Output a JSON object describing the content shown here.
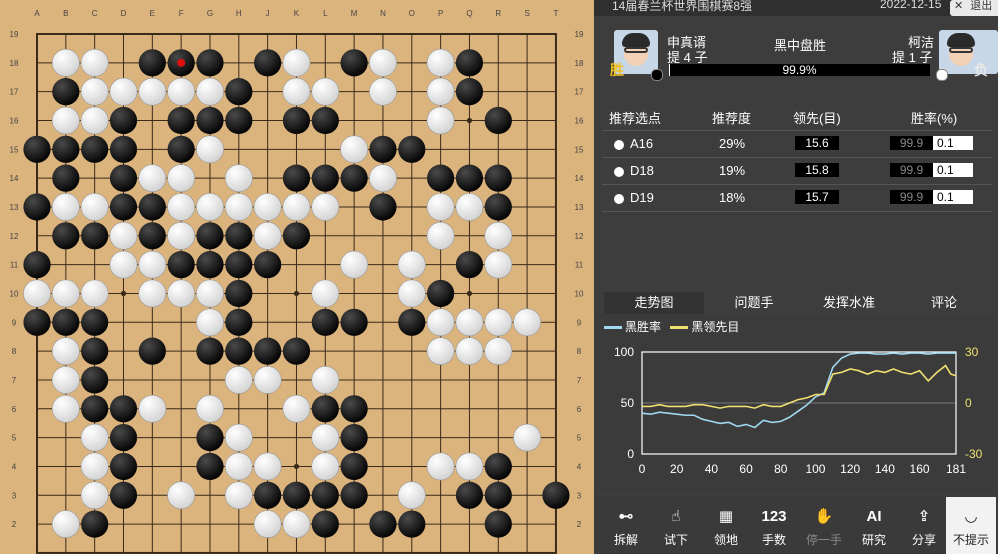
{
  "board": {
    "col_labels": [
      "A",
      "B",
      "C",
      "D",
      "E",
      "F",
      "G",
      "H",
      "J",
      "K",
      "L",
      "M",
      "N",
      "O",
      "P",
      "Q",
      "R",
      "S",
      "T"
    ],
    "row_labels_visible": [
      "19",
      "18",
      "17",
      "16",
      "15",
      "14",
      "13",
      "12",
      "11",
      "10",
      "9",
      "8",
      "7",
      "6",
      "5",
      "4",
      "3",
      "2"
    ],
    "last_move": "F18",
    "colors": {
      "wood": "#dbb37d",
      "line": "#3a2a18",
      "last_move_marker": "#e01010"
    },
    "stones": {
      "black": [
        "E18",
        "F18",
        "G18",
        "J18",
        "M18",
        "Q18",
        "B17",
        "H17",
        "Q17",
        "D16",
        "F16",
        "G16",
        "H16",
        "K16",
        "L16",
        "R16",
        "A15",
        "B15",
        "C15",
        "D15",
        "F15",
        "N15",
        "O15",
        "B14",
        "D14",
        "K14",
        "L14",
        "M14",
        "P14",
        "Q14",
        "R14",
        "A13",
        "D13",
        "E13",
        "N13",
        "R13",
        "B12",
        "C12",
        "E12",
        "G12",
        "H12",
        "K12",
        "A11",
        "F11",
        "G11",
        "H11",
        "J11",
        "Q11",
        "H10",
        "P10",
        "A9",
        "B9",
        "C9",
        "H9",
        "L9",
        "M9",
        "O9",
        "C8",
        "E8",
        "G8",
        "H8",
        "J8",
        "K8",
        "C7",
        "C6",
        "D6",
        "L6",
        "M6",
        "D5",
        "G5",
        "M5",
        "D4",
        "G4",
        "M4",
        "R4",
        "D3",
        "J3",
        "K3",
        "L3",
        "M3",
        "Q3",
        "R3",
        "T3",
        "C2",
        "L2",
        "N2",
        "O2",
        "R2"
      ],
      "white": [
        "B18",
        "C18",
        "K18",
        "N18",
        "P18",
        "C17",
        "D17",
        "E17",
        "F17",
        "G17",
        "K17",
        "L17",
        "N17",
        "P17",
        "B16",
        "C16",
        "P16",
        "G15",
        "M15",
        "E14",
        "F14",
        "H14",
        "N14",
        "B13",
        "C13",
        "F13",
        "G13",
        "H13",
        "J13",
        "K13",
        "L13",
        "P13",
        "Q13",
        "D12",
        "F12",
        "J12",
        "P12",
        "R12",
        "D11",
        "E11",
        "M11",
        "O11",
        "R11",
        "A10",
        "B10",
        "C10",
        "E10",
        "F10",
        "G10",
        "L10",
        "O10",
        "G9",
        "P9",
        "Q9",
        "R9",
        "S9",
        "B8",
        "P8",
        "Q8",
        "R8",
        "B7",
        "H7",
        "J7",
        "L7",
        "B6",
        "E6",
        "G6",
        "K6",
        "C5",
        "H5",
        "L5",
        "S5",
        "C4",
        "H4",
        "J4",
        "L4",
        "P4",
        "Q4",
        "C3",
        "F3",
        "H3",
        "O3",
        "B2",
        "J2",
        "K2"
      ]
    }
  },
  "panel": {
    "title": "14届春兰杯世界围棋赛8强",
    "date": "2022-12-15",
    "close_label": "退出",
    "result": "黑中盘胜",
    "black_player": {
      "name": "申真谞",
      "captures": "提 4 子",
      "win_badge": "胜"
    },
    "white_player": {
      "name": "柯洁",
      "captures": "提 1 子",
      "loss_badge": "负"
    },
    "winrate_text": "99.9%",
    "winrate_value": 99.9,
    "table": {
      "headers": [
        "推荐选点",
        "推荐度",
        "领先(目)",
        "胜率(%)"
      ],
      "rows": [
        {
          "move": "A16",
          "pct": "29%",
          "lead": "15.6",
          "win_black": "99.9",
          "win_white": "0.1"
        },
        {
          "move": "D18",
          "pct": "19%",
          "lead": "15.8",
          "win_black": "99.9",
          "win_white": "0.1"
        },
        {
          "move": "D19",
          "pct": "18%",
          "lead": "15.7",
          "win_black": "99.9",
          "win_white": "0.1"
        }
      ]
    },
    "tabs": [
      "走势图",
      "问题手",
      "发挥水准",
      "评论"
    ],
    "active_tab": 0,
    "toolbar": [
      {
        "label": "拆解",
        "icon": "split-icon",
        "glyph": "⊷",
        "disabled": false
      },
      {
        "label": "试下",
        "icon": "hand-point-icon",
        "glyph": "☝",
        "disabled": false
      },
      {
        "label": "领地",
        "icon": "territory-icon",
        "glyph": "▦",
        "disabled": false
      },
      {
        "label": "手数",
        "icon": "move-number-icon",
        "glyph": "123",
        "disabled": false
      },
      {
        "label": "停一手",
        "icon": "palm-icon",
        "glyph": "✋",
        "disabled": true
      },
      {
        "label": "研究",
        "icon": "ai-icon",
        "glyph": "AI",
        "disabled": false
      },
      {
        "label": "分享",
        "icon": "share-icon",
        "glyph": "⇪",
        "disabled": false
      },
      {
        "label": "不提示",
        "icon": "eye-closed-icon",
        "glyph": "◡",
        "disabled": false,
        "highlight": true
      }
    ]
  },
  "chart_data": {
    "type": "line",
    "legend": [
      "黑胜率",
      "黑领先目"
    ],
    "colors": {
      "winrate": "#9fd8f0",
      "lead": "#f0e070",
      "grid": "#7a7a7a",
      "frame": "#ffffff"
    },
    "xlim": [
      0,
      181
    ],
    "x_ticks": [
      0,
      20,
      40,
      60,
      80,
      100,
      120,
      140,
      160,
      181
    ],
    "ylim_left": [
      0,
      100
    ],
    "y_ticks_left": [
      0,
      50,
      100
    ],
    "ylim_right": [
      -30,
      30
    ],
    "y_ticks_right": [
      -30,
      0,
      30
    ],
    "series": [
      {
        "name": "黑胜率",
        "axis": "left",
        "x": [
          0,
          5,
          10,
          15,
          20,
          25,
          30,
          35,
          40,
          45,
          50,
          55,
          60,
          65,
          70,
          75,
          80,
          85,
          90,
          95,
          100,
          105,
          110,
          115,
          120,
          125,
          130,
          135,
          140,
          145,
          150,
          155,
          160,
          165,
          170,
          175,
          178,
          181
        ],
        "y": [
          40,
          39,
          41,
          40,
          39,
          38,
          38,
          34,
          32,
          30,
          31,
          27,
          29,
          26,
          33,
          31,
          32,
          36,
          42,
          48,
          56,
          60,
          85,
          94,
          98,
          99,
          99,
          98,
          98,
          99,
          98,
          99,
          99,
          98,
          99,
          99,
          99,
          99
        ]
      },
      {
        "name": "黑领先目",
        "axis": "right",
        "x": [
          0,
          5,
          10,
          15,
          20,
          25,
          30,
          35,
          40,
          45,
          50,
          55,
          60,
          65,
          70,
          75,
          80,
          85,
          90,
          95,
          100,
          105,
          110,
          115,
          120,
          125,
          130,
          135,
          140,
          145,
          150,
          155,
          160,
          165,
          170,
          175,
          178,
          181
        ],
        "y": [
          -2,
          -2,
          -1,
          -2,
          -2,
          -2,
          -1,
          -1,
          -2,
          -3,
          -2,
          -2,
          -2,
          -3,
          -1,
          -2,
          -2,
          0,
          2,
          3,
          5,
          5,
          17,
          18,
          20,
          19,
          17,
          19,
          18,
          20,
          18,
          17,
          19,
          13,
          18,
          22,
          17,
          16
        ]
      }
    ]
  }
}
